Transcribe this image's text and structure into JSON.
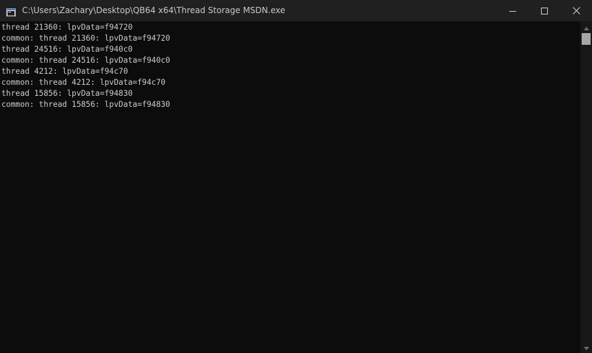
{
  "window": {
    "title": "C:\\Users\\Zachary\\Desktop\\QB64 x64\\Thread Storage MSDN.exe",
    "icon": "console-app-icon",
    "controls": {
      "minimize_icon": "minimize-icon",
      "maximize_icon": "maximize-icon",
      "close_icon": "close-icon"
    }
  },
  "console": {
    "lines": [
      "thread 21360: lpvData=f94720",
      "common: thread 21360: lpvData=f94720",
      "thread 24516: lpvData=f940c0",
      "common: thread 24516: lpvData=f940c0",
      "thread 4212: lpvData=f94c70",
      "common: thread 4212: lpvData=f94c70",
      "thread 15856: lpvData=f94830",
      "common: thread 15856: lpvData=f94830"
    ],
    "text_color": "#cccccc",
    "background_color": "#0c0c0c"
  },
  "scrollbar": {
    "up_icon": "scroll-up-arrow-icon",
    "down_icon": "scroll-down-arrow-icon",
    "position": 0
  }
}
